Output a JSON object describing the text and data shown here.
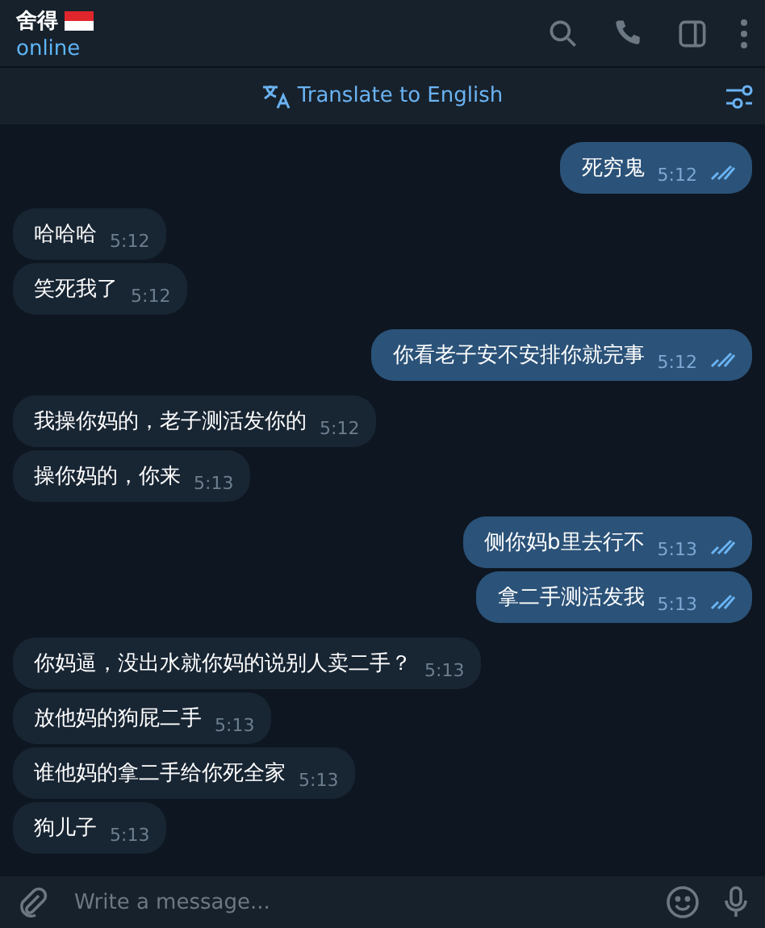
{
  "header": {
    "name": "舍得",
    "status": "online"
  },
  "translate_bar": {
    "label": "Translate to English"
  },
  "groups": [
    {
      "kind": "outgoing",
      "messages": [
        {
          "text": "死穷鬼",
          "time": "5:12",
          "read": true
        }
      ]
    },
    {
      "kind": "incoming",
      "messages": [
        {
          "text": "哈哈哈",
          "time": "5:12"
        },
        {
          "text": "笑死我了",
          "time": "5:12"
        }
      ]
    },
    {
      "kind": "outgoing",
      "messages": [
        {
          "text": "你看老子安不安排你就完事",
          "time": "5:12",
          "read": true
        }
      ]
    },
    {
      "kind": "incoming",
      "messages": [
        {
          "text": "我操你妈的，老子测活发你的",
          "time": "5:12"
        },
        {
          "text": "操你妈的，你来",
          "time": "5:13"
        }
      ]
    },
    {
      "kind": "outgoing",
      "messages": [
        {
          "text": "侧你妈b里去行不",
          "time": "5:13",
          "read": true
        },
        {
          "text": "拿二手测活发我",
          "time": "5:13",
          "read": true
        }
      ]
    },
    {
      "kind": "incoming",
      "messages": [
        {
          "text": "你妈逼，没出水就你妈的说别人卖二手？",
          "time": "5:13"
        },
        {
          "text": "放他妈的狗屁二手",
          "time": "5:13"
        },
        {
          "text": "谁他妈的拿二手给你死全家",
          "time": "5:13"
        },
        {
          "text": "狗儿子",
          "time": "5:13"
        }
      ]
    }
  ],
  "composer": {
    "placeholder": "Write a message..."
  }
}
